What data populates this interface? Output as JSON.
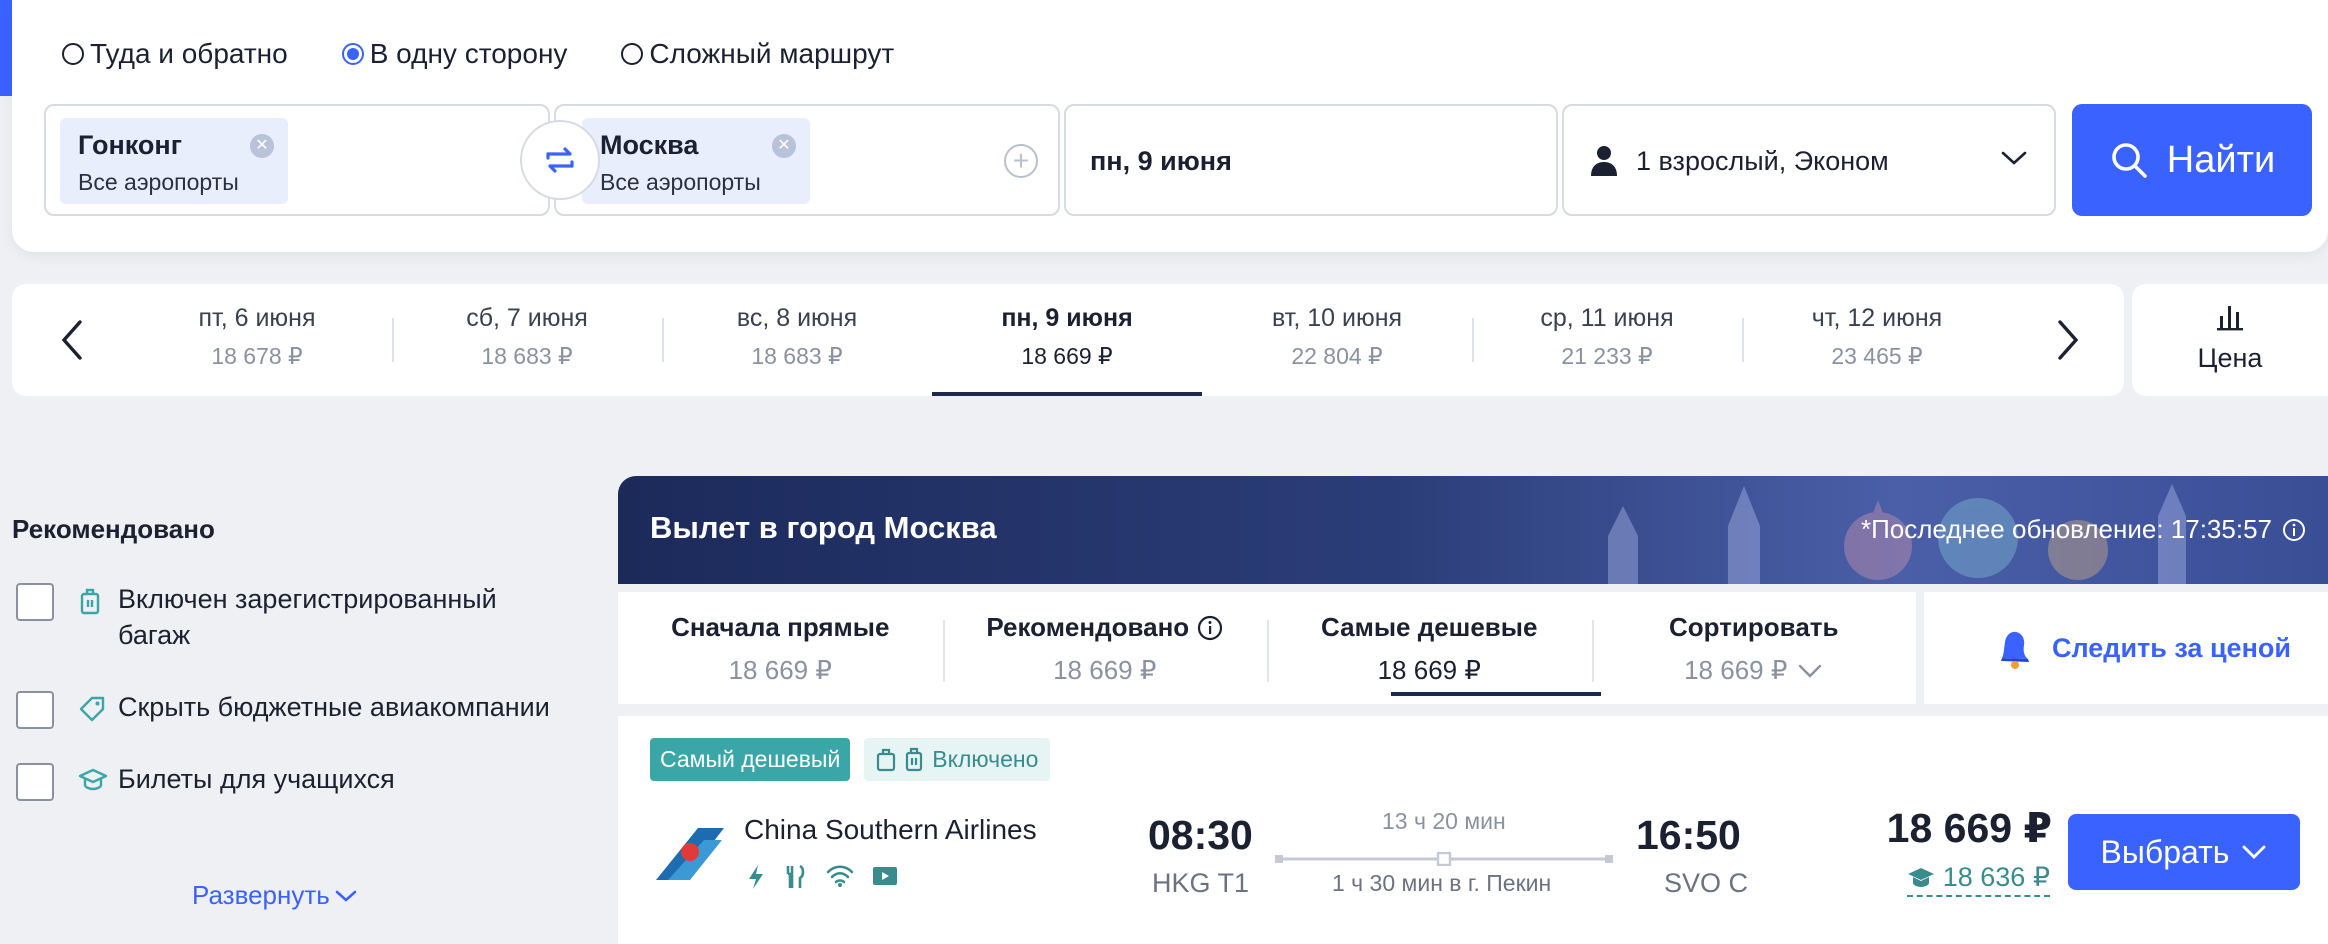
{
  "trip_types": [
    {
      "label": "Туда и обратно",
      "checked": false
    },
    {
      "label": "В одну сторону",
      "checked": true
    },
    {
      "label": "Сложный маршрут",
      "checked": false
    }
  ],
  "origin": {
    "city": "Гонконг",
    "airports": "Все аэропорты"
  },
  "destination": {
    "city": "Москва",
    "airports": "Все аэропорты"
  },
  "date": "пн, 9 июня",
  "passengers": "1 взрослый, Эконом",
  "search_label": "Найти",
  "date_strip": [
    {
      "label": "пт, 6 июня",
      "price": "18 678 ₽"
    },
    {
      "label": "сб, 7 июня",
      "price": "18 683 ₽"
    },
    {
      "label": "вс, 8 июня",
      "price": "18 683 ₽"
    },
    {
      "label": "пн, 9 июня",
      "price": "18 669 ₽",
      "active": true
    },
    {
      "label": "вт, 10 июня",
      "price": "22 804 ₽"
    },
    {
      "label": "ср, 11 июня",
      "price": "21 233 ₽"
    },
    {
      "label": "чт, 12 июня",
      "price": "23 465 ₽"
    }
  ],
  "price_graph_label": "Цена",
  "filters": {
    "title": "Рекомендовано",
    "items": [
      {
        "label": "Включен зарегистрированный багаж"
      },
      {
        "label": "Скрыть бюджетные авиакомпании"
      },
      {
        "label": "Билеты для учащихся"
      }
    ],
    "expand": "Развернуть"
  },
  "banner": {
    "title": "Вылет в город Москва",
    "updated": "*Последнее обновление: 17:35:57"
  },
  "sort_tabs": [
    {
      "label": "Сначала прямые",
      "price": "18 669 ₽"
    },
    {
      "label": "Рекомендовано",
      "price": "18 669 ₽"
    },
    {
      "label": "Самые дешевые",
      "price": "18 669 ₽",
      "active": true
    },
    {
      "label": "Сортировать",
      "price": "18 669 ₽"
    }
  ],
  "track_price": "Следить за ценой",
  "flight": {
    "badge_cheapest": "Самый дешевый",
    "badge_baggage": "Включено",
    "airline": "China Southern Airlines",
    "dep_time": "08:30",
    "dep_code": "HKG T1",
    "duration": "13 ч 20 мин",
    "transfer": "1 ч 30 мин в г. Пекин",
    "arr_time": "16:50",
    "arr_code": "SVO C",
    "price": "18 669 ₽",
    "student_price": "18 636 ₽",
    "select_label": "Выбрать"
  },
  "colors": {
    "accent": "#3a62ff",
    "teal": "#3ba6a8",
    "navy": "#1c2a5a"
  }
}
